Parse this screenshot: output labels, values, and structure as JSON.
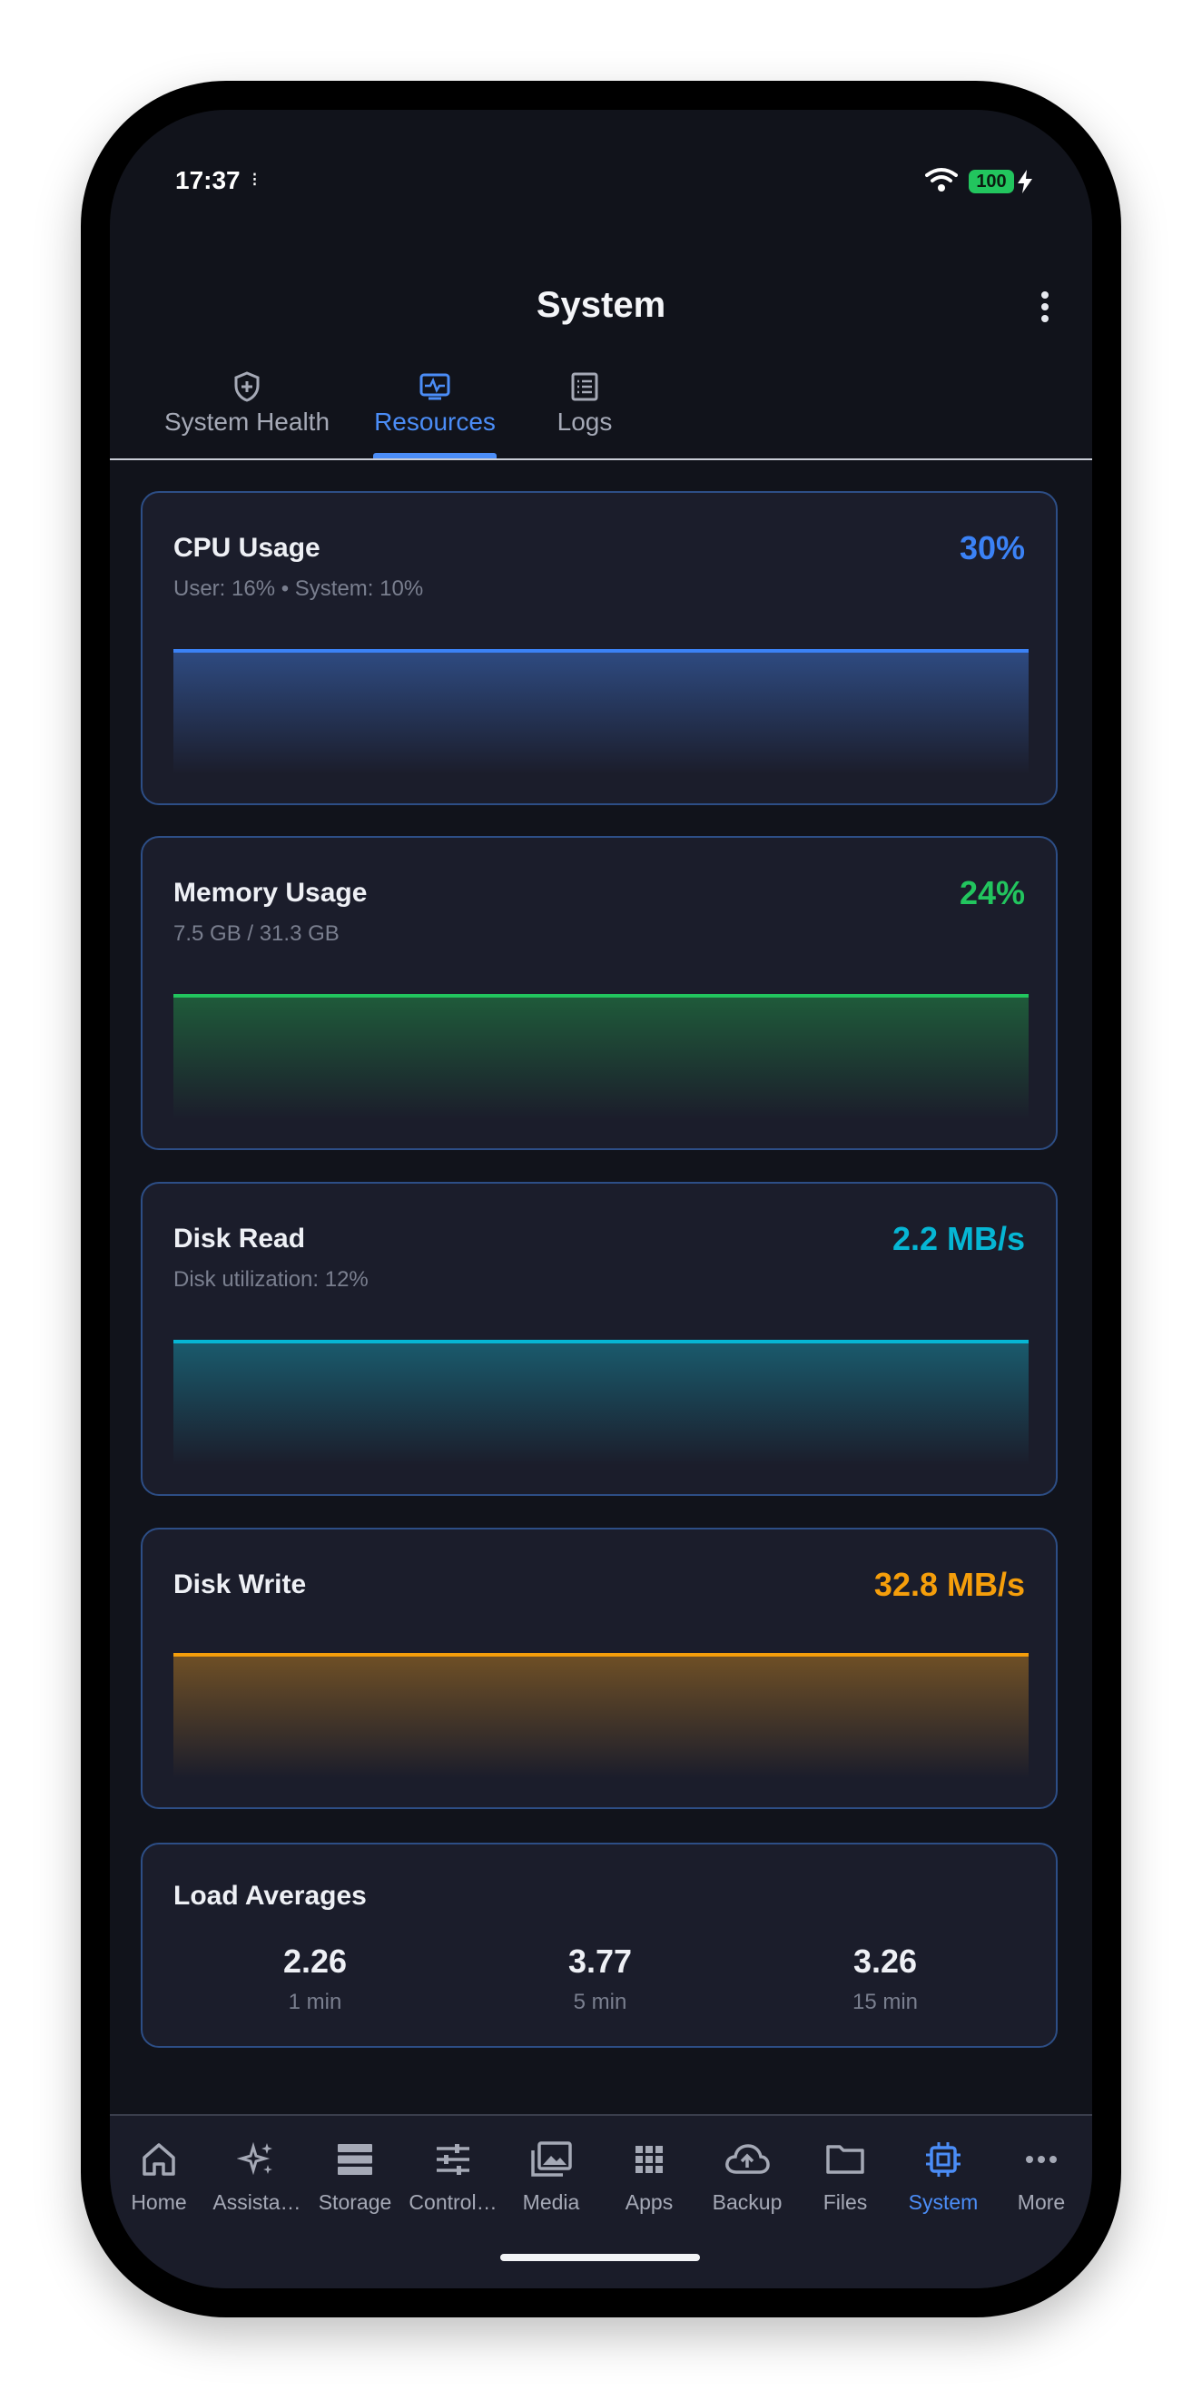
{
  "status_bar": {
    "time": "17:37",
    "battery": "100"
  },
  "header": {
    "title": "System"
  },
  "tabs": [
    {
      "label": "System Health",
      "icon": "shield-plus-icon"
    },
    {
      "label": "Resources",
      "icon": "monitor-pulse-icon",
      "active": true
    },
    {
      "label": "Logs",
      "icon": "list-doc-icon"
    }
  ],
  "cards": {
    "cpu": {
      "title": "CPU Usage",
      "value": "30%",
      "subtitle": "User: 16% • System: 10%",
      "color": "#3b82f6"
    },
    "memory": {
      "title": "Memory Usage",
      "value": "24%",
      "subtitle": "7.5 GB / 31.3 GB",
      "color": "#22c55e"
    },
    "disk_read": {
      "title": "Disk Read",
      "value": "2.2 MB/s",
      "subtitle": "Disk utilization: 12%",
      "color": "#06b6d4"
    },
    "disk_write": {
      "title": "Disk Write",
      "value": "32.8 MB/s",
      "color": "#f59e0b"
    }
  },
  "load_averages": {
    "title": "Load Averages",
    "items": [
      {
        "value": "2.26",
        "label": "1 min"
      },
      {
        "value": "3.77",
        "label": "5 min"
      },
      {
        "value": "3.26",
        "label": "15 min"
      }
    ]
  },
  "bottom_nav": [
    {
      "label": "Home",
      "icon": "home-icon"
    },
    {
      "label": "Assista…",
      "icon": "sparkles-icon"
    },
    {
      "label": "Storage",
      "icon": "storage-icon"
    },
    {
      "label": "Control…",
      "icon": "sliders-icon"
    },
    {
      "label": "Media",
      "icon": "media-icon"
    },
    {
      "label": "Apps",
      "icon": "apps-grid-icon"
    },
    {
      "label": "Backup",
      "icon": "cloud-upload-icon"
    },
    {
      "label": "Files",
      "icon": "folder-icon"
    },
    {
      "label": "System",
      "icon": "chip-icon",
      "active": true
    },
    {
      "label": "More",
      "icon": "more-dots-icon"
    }
  ]
}
